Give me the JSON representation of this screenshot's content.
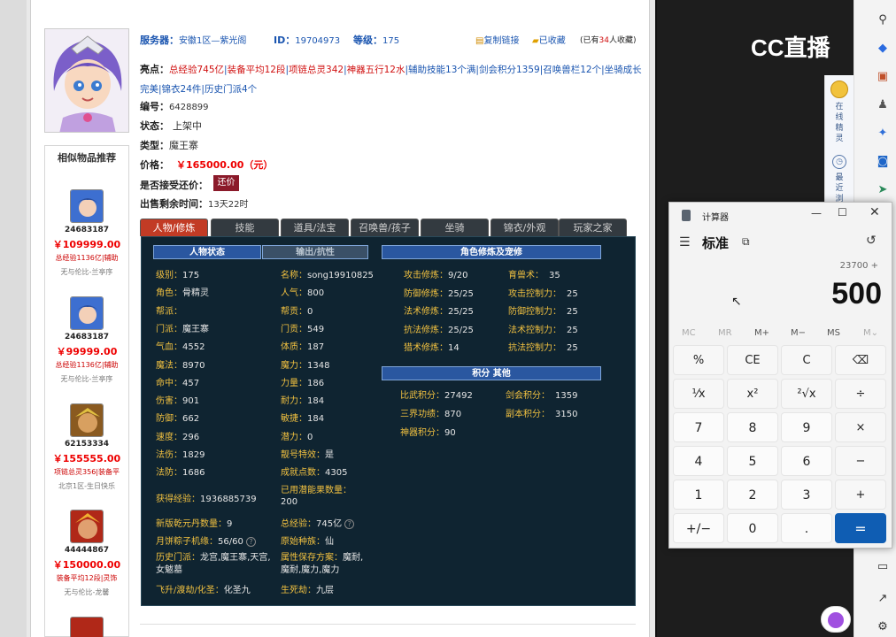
{
  "listing": {
    "server_label": "服务器：",
    "server_value": "安徽1区—紫光阁",
    "id_label": "ID：",
    "id_value": "19704973",
    "level_label": "等级：",
    "level_value": "175",
    "copy_link": "复制链接",
    "favorited": "已收藏",
    "fav_count_prefix": "(已有",
    "fav_count": "34",
    "fav_count_suffix": "人收藏)",
    "highlights_label": "亮点：",
    "highlights": [
      "总经验745亿",
      "装备平均12段",
      "项链总灵342",
      "神器五行12水",
      "辅助技能13个满",
      "剑会积分1359",
      "召唤兽栏12个",
      "坐骑成长完美",
      "锦衣24件",
      "历史门派4个"
    ],
    "number_label": "编号：",
    "number_value": "6428899",
    "status_label": "状态：",
    "status_value": "上架中",
    "type_label": "类型：",
    "type_value": "魔王寨",
    "price_label": "价格：",
    "price_value": "￥165000.00（元）",
    "bargain_label": "是否接受还价：",
    "bargain_button": "还价",
    "time_label": "出售剩余时间：",
    "time_value": "13天22时"
  },
  "similar": {
    "title": "相似物品推荐",
    "items": [
      {
        "id": "24683187",
        "price": "￥109999.00",
        "desc": "总经验1136亿|辅助",
        "server": "无与伦比-兰亭序"
      },
      {
        "id": "24683187",
        "price": "￥99999.00",
        "desc": "总经验1136亿|辅助",
        "server": "无与伦比-兰亭序"
      },
      {
        "id": "62153334",
        "price": "￥155555.00",
        "desc": "项链总灵356|装备平",
        "server": "北京1区-生日快乐"
      },
      {
        "id": "44444867",
        "price": "￥150000.00",
        "desc": "装备平均12段|灵饰",
        "server": "无与伦比-龙馨"
      }
    ]
  },
  "tabs": [
    "人物/修炼",
    "技能",
    "道具/法宝",
    "召唤兽/孩子",
    "坐骑",
    "锦衣/外观",
    "玩家之家"
  ],
  "panel": {
    "status_header": "人物状态",
    "output_header": "输出/抗性",
    "cultivation_header": "角色修炼及宠修",
    "points_header": "积分  其他",
    "col1": [
      {
        "k": "级别：",
        "v": "175"
      },
      {
        "k": "角色：",
        "v": "骨精灵"
      },
      {
        "k": "帮派：",
        "v": ""
      },
      {
        "k": "门派：",
        "v": "魔王寨"
      },
      {
        "k": "气血：",
        "v": "4552"
      },
      {
        "k": "魔法：",
        "v": "8970"
      },
      {
        "k": "命中：",
        "v": "457"
      },
      {
        "k": "伤害：",
        "v": "901"
      },
      {
        "k": "防御：",
        "v": "662"
      },
      {
        "k": "速度：",
        "v": "296"
      },
      {
        "k": "法伤：",
        "v": "1829"
      },
      {
        "k": "法防：",
        "v": "1686"
      }
    ],
    "col2": [
      {
        "k": "名称：",
        "v": "song19910825"
      },
      {
        "k": "人气：",
        "v": "800"
      },
      {
        "k": "帮贡：",
        "v": "0"
      },
      {
        "k": "门贡：",
        "v": "549"
      },
      {
        "k": "体质：",
        "v": "187"
      },
      {
        "k": "魔力：",
        "v": "1348"
      },
      {
        "k": "力量：",
        "v": "186"
      },
      {
        "k": "耐力：",
        "v": "184"
      },
      {
        "k": "敏捷：",
        "v": "184"
      },
      {
        "k": "潜力：",
        "v": "0"
      },
      {
        "k": "靓号特效：",
        "v": "是"
      },
      {
        "k": "成就点数：",
        "v": "4305"
      }
    ],
    "exp_label": "获得经验：",
    "exp_value": "1936885739",
    "potential_label": "已用潜能果数量：",
    "potential_value": "200",
    "qianyuan_label": "新版乾元丹数量：",
    "qianyuan_value": "9",
    "total_exp_label": "总经验：",
    "total_exp_value": "745亿",
    "zongzi_label": "月饼粽子机缘：",
    "zongzi_value": "56/60",
    "race_label": "原始种族：",
    "race_value": "仙",
    "history_label": "历史门派：",
    "history_value": "龙宫,魔王寨,天宫,女魃墓",
    "attr_label": "属性保存方案：",
    "attr_value": "魔耐,魔耐,魔力,魔力",
    "ascend_label": "飞升/渡劫/化圣：",
    "ascend_value": "化圣九",
    "life_label": "生死劫：",
    "life_value": "九层",
    "cult": [
      {
        "k": "攻击修炼：",
        "v": "9/20",
        "k2": "育兽术：",
        "v2": "35"
      },
      {
        "k": "防御修炼：",
        "v": "25/25",
        "k2": "攻击控制力：",
        "v2": "25"
      },
      {
        "k": "法术修炼：",
        "v": "25/25",
        "k2": "防御控制力：",
        "v2": "25"
      },
      {
        "k": "抗法修炼：",
        "v": "25/25",
        "k2": "法术控制力：",
        "v2": "25"
      },
      {
        "k": "猎术修炼：",
        "v": "14",
        "k2": "抗法控制力：",
        "v2": "25"
      }
    ],
    "points": [
      {
        "k": "比武积分：",
        "v": "27492",
        "k2": "剑会积分：",
        "v2": "1359"
      },
      {
        "k": "三界功绩：",
        "v": "870",
        "k2": "副本积分：",
        "v2": "3150"
      },
      {
        "k": "神器积分：",
        "v": "90",
        "k2": "",
        "v2": ""
      }
    ]
  },
  "cc": {
    "logo_text": "CC直播"
  },
  "sidebar": {
    "online": "在线精灵",
    "recent": "最近浏览"
  },
  "calculator": {
    "title": "计算器",
    "mode": "标准",
    "expression": "23700 +",
    "display": "500",
    "memory": [
      "MC",
      "MR",
      "M+",
      "M−",
      "MS",
      "M⌄"
    ],
    "buttons": [
      [
        "%",
        "CE",
        "C",
        "⌫"
      ],
      [
        "¹⁄x",
        "x²",
        "²√x",
        "÷"
      ],
      [
        "7",
        "8",
        "9",
        "×"
      ],
      [
        "4",
        "5",
        "6",
        "−"
      ],
      [
        "1",
        "2",
        "3",
        "+"
      ],
      [
        "+/−",
        "0",
        ".",
        "="
      ]
    ]
  },
  "colors": {
    "accent": "#0f5db3",
    "price_red": "#e00000",
    "panel_bg": "#0f2431",
    "tab_active": "#c23b25"
  }
}
